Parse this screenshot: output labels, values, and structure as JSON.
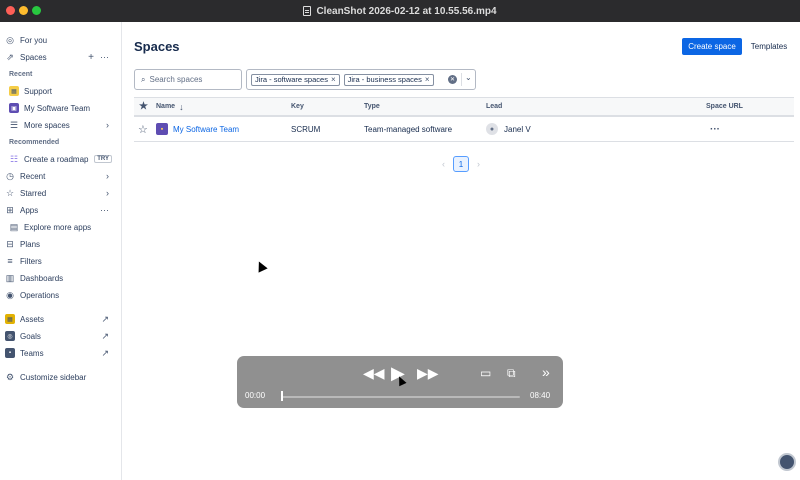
{
  "window": {
    "title": "CleanShot 2026-02-12 at 10.55.56.mp4"
  },
  "sidebar": {
    "for_you": "For you",
    "spaces": "Spaces",
    "recent_heading": "Recent",
    "recent_items": [
      "Support",
      "My Software Team"
    ],
    "more_spaces": "More spaces",
    "recommended_heading": "Recommended",
    "create_roadmap": "Create a roadmap",
    "try_badge": "TRY",
    "recent": "Recent",
    "starred": "Starred",
    "apps": "Apps",
    "explore_apps": "Explore more apps",
    "plans": "Plans",
    "filters": "Filters",
    "dashboards": "Dashboards",
    "operations": "Operations",
    "assets": "Assets",
    "goals": "Goals",
    "teams": "Teams",
    "customize": "Customize sidebar"
  },
  "main": {
    "title": "Spaces",
    "create_button": "Create space",
    "templates_button": "Templates",
    "search_placeholder": "Search spaces",
    "filter_chips": [
      "Jira - software spaces",
      "Jira - business spaces"
    ],
    "columns": {
      "name": "Name",
      "key": "Key",
      "type": "Type",
      "lead": "Lead",
      "url": "Space URL"
    },
    "rows": [
      {
        "name": "My Software Team",
        "key": "SCRUM",
        "type": "Team-managed software",
        "lead": "Janel V"
      }
    ],
    "pagination": {
      "current": "1"
    }
  },
  "player": {
    "current_time": "00:00",
    "duration": "08:40",
    "progress": 0.0
  },
  "colors": {
    "accent": "#0c66e4",
    "titlebar": "#2b2b2d",
    "project_icon": "#5e4db2"
  }
}
